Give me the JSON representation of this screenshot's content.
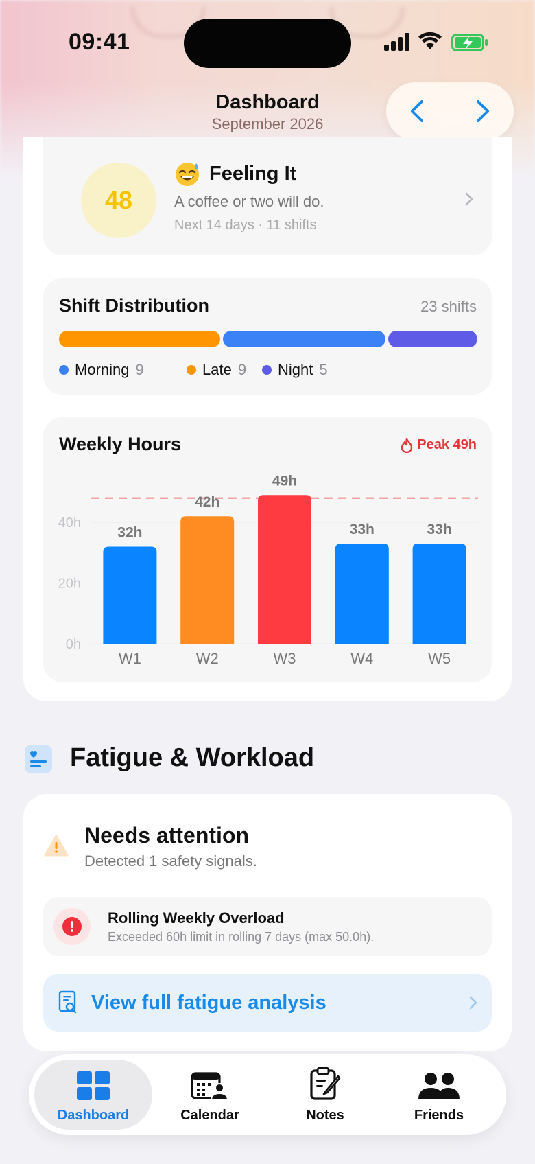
{
  "status": {
    "time": "09:41"
  },
  "header": {
    "title": "Dashboard",
    "subtitle": "September 2026"
  },
  "feeling": {
    "score": "48",
    "title": "Feeling It",
    "description": "A coffee or two will do.",
    "meta": "Next 14 days · 11 shifts",
    "emoji": "sweat-smile-emoji"
  },
  "distribution": {
    "title": "Shift Distribution",
    "count": "23 shifts",
    "legend": [
      {
        "label": "Morning",
        "value": "9",
        "color": "#3b82f6"
      },
      {
        "label": "Late",
        "value": "9",
        "color": "#ff9500"
      },
      {
        "label": "Night",
        "value": "5",
        "color": "#5e5ce6"
      }
    ],
    "bar_order": [
      "Late",
      "Morning",
      "Night"
    ]
  },
  "weekly": {
    "title": "Weekly Hours",
    "peak": "Peak 49h",
    "chart_data": {
      "type": "bar",
      "categories": [
        "W1",
        "W2",
        "W3",
        "W4",
        "W5"
      ],
      "values": [
        32,
        42,
        49,
        33,
        33
      ],
      "value_labels": [
        "32h",
        "42h",
        "49h",
        "33h",
        "33h"
      ],
      "bar_colors": [
        "#0a84ff",
        "#ff8c23",
        "#ff3b42",
        "#0a84ff",
        "#0a84ff"
      ],
      "y_ticks": [
        0,
        20,
        40
      ],
      "y_tick_labels": [
        "0h",
        "20h",
        "40h"
      ],
      "ylim": [
        0,
        52
      ],
      "reference_line": 48,
      "grid": true
    }
  },
  "section": {
    "title": "Fatigue & Workload"
  },
  "fatigue": {
    "title": "Needs attention",
    "subtitle": "Detected 1 safety signals.",
    "signal_title": "Rolling Weekly Overload",
    "signal_desc": "Exceeded 60h limit in rolling 7 days (max 50.0h).",
    "cta": "View full fatigue analysis"
  },
  "tabs": [
    {
      "label": "Dashboard",
      "icon": "grid-icon",
      "active": true
    },
    {
      "label": "Calendar",
      "icon": "calendar-person-icon",
      "active": false
    },
    {
      "label": "Notes",
      "icon": "clipboard-pencil-icon",
      "active": false
    },
    {
      "label": "Friends",
      "icon": "people-icon",
      "active": false
    }
  ]
}
